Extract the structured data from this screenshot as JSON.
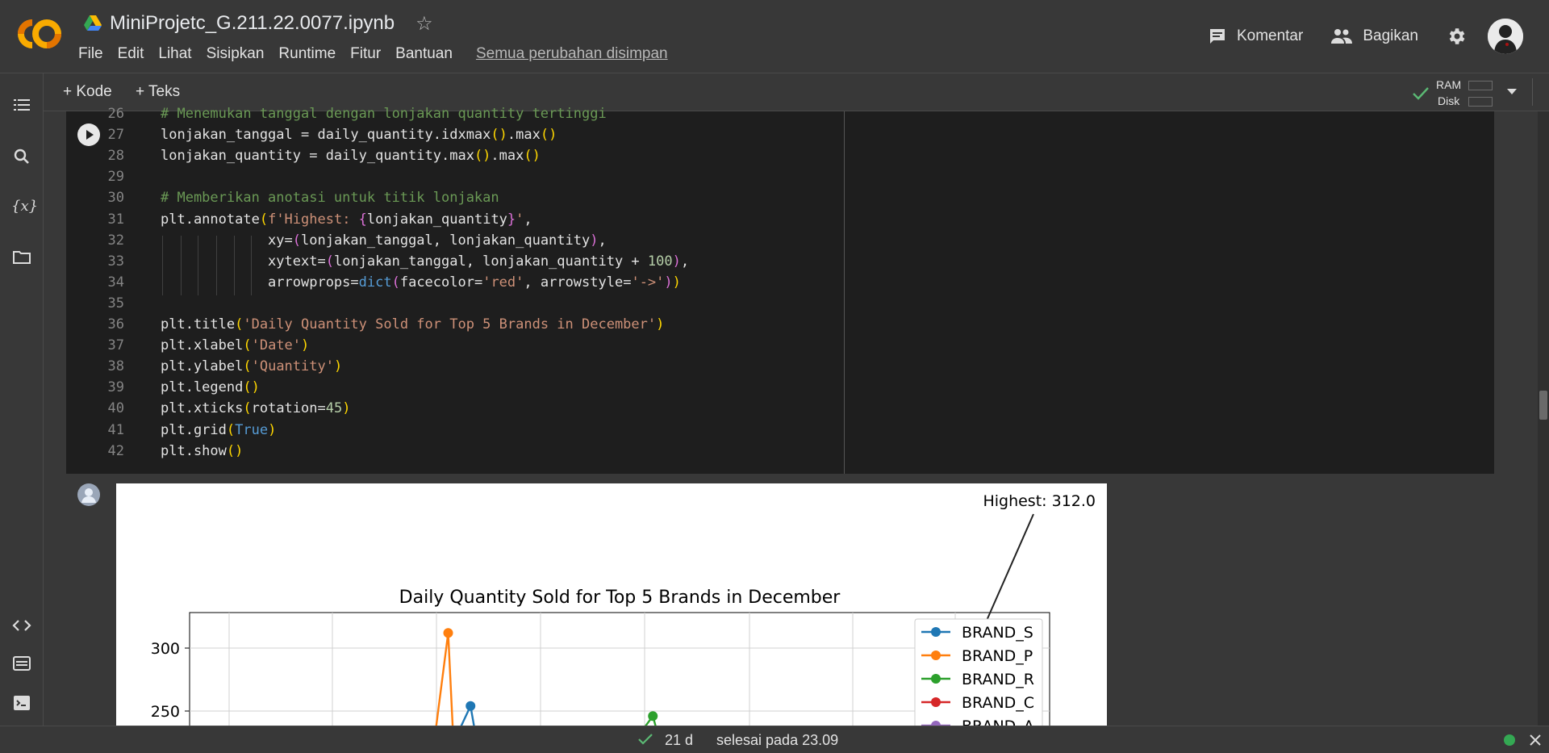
{
  "app": {
    "doc_title": "MiniProjetc_G.211.22.0077.ipynb",
    "menu": [
      "File",
      "Edit",
      "Lihat",
      "Sisipkan",
      "Runtime",
      "Fitur",
      "Bantuan"
    ],
    "saved_status": "Semua perubahan disimpan",
    "comment_label": "Komentar",
    "share_label": "Bagikan"
  },
  "toolbar": {
    "add_code": "+ Kode",
    "add_text": "+ Teks",
    "ram_label": "RAM",
    "disk_label": "Disk"
  },
  "code_lines": [
    {
      "n": "26",
      "html": "<span class='cm'># Menemukan tanggal dengan lonjakan quantity tertinggi</span>"
    },
    {
      "n": "27",
      "html": "lonjakan_tanggal = daily_quantity.idxmax<span class='par'>()</span>.max<span class='par'>()</span>"
    },
    {
      "n": "28",
      "html": "lonjakan_quantity = daily_quantity.max<span class='par'>()</span>.max<span class='par'>()</span>"
    },
    {
      "n": "29",
      "html": ""
    },
    {
      "n": "30",
      "html": "<span class='cm'># Memberikan anotasi untuk titik lonjakan</span>"
    },
    {
      "n": "31",
      "html": "plt.annotate<span class='par'>(</span><span class='str'>f'Highest: </span><span class='par2'>{</span>lonjakan_quantity<span class='par2'>}</span><span class='str'>'</span>,"
    },
    {
      "n": "32",
      "html": "             xy=<span class='par2'>(</span>lonjakan_tanggal, lonjakan_quantity<span class='par2'>)</span>,"
    },
    {
      "n": "33",
      "html": "             xytext=<span class='par2'>(</span>lonjakan_tanggal, lonjakan_quantity + <span class='num'>100</span><span class='par2'>)</span>,"
    },
    {
      "n": "34",
      "html": "             arrowprops=<span class='kw'>dict</span><span class='par2'>(</span>facecolor=<span class='str'>'red'</span>, arrowstyle=<span class='str'>'->'</span><span class='par2'>)</span><span class='par'>)</span>"
    },
    {
      "n": "35",
      "html": ""
    },
    {
      "n": "36",
      "html": "plt.title<span class='par'>(</span><span class='str'>'Daily Quantity Sold for Top 5 Brands in December'</span><span class='par'>)</span>"
    },
    {
      "n": "37",
      "html": "plt.xlabel<span class='par'>(</span><span class='str'>'Date'</span><span class='par'>)</span>"
    },
    {
      "n": "38",
      "html": "plt.ylabel<span class='par'>(</span><span class='str'>'Quantity'</span><span class='par'>)</span>"
    },
    {
      "n": "39",
      "html": "plt.legend<span class='par'>()</span>"
    },
    {
      "n": "40",
      "html": "plt.xticks<span class='par'>(</span>rotation=<span class='num'>45</span><span class='par'>)</span>"
    },
    {
      "n": "41",
      "html": "plt.grid<span class='par'>(</span><span class='kw'>True</span><span class='par'>)</span>"
    },
    {
      "n": "42",
      "html": "plt.show<span class='par'>()</span>"
    }
  ],
  "chart_data": {
    "type": "line",
    "title": "Daily Quantity Sold for Top 5 Brands in December",
    "annotation": "Highest: 312.0",
    "yticks": [
      300,
      250
    ],
    "ylim_visible": [
      233,
      327
    ],
    "grid": true,
    "legend_position": "top-right",
    "series": [
      {
        "name": "BRAND_S",
        "color": "#1f77b4",
        "visible_points": [
          {
            "x_frac": 0.261,
            "y": 254
          }
        ]
      },
      {
        "name": "BRAND_P",
        "color": "#ff7f0e",
        "visible_points": [
          {
            "x_frac": 0.235,
            "y": 312
          }
        ]
      },
      {
        "name": "BRAND_R",
        "color": "#2ca02c",
        "visible_points": [
          {
            "x_frac": 0.473,
            "y": 246
          }
        ]
      },
      {
        "name": "BRAND_C",
        "color": "#d62728",
        "visible_points": []
      },
      {
        "name": "BRAND_A",
        "color": "#9467bd",
        "visible_points": []
      }
    ]
  },
  "status": {
    "elapsed": "21 d",
    "finished": "selesai pada 23.09"
  }
}
